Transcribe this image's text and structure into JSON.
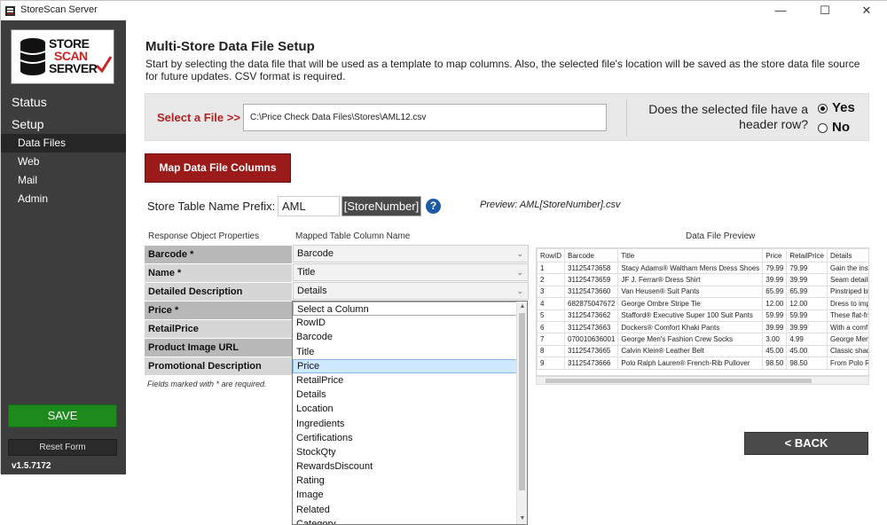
{
  "window": {
    "title": "StoreScan Server",
    "controls": {
      "minimize": "—",
      "maximize": "☐",
      "close": "✕"
    }
  },
  "logo": {
    "line1": "STORE",
    "line2": "SCAN",
    "line3": "SERVER"
  },
  "sidebar": {
    "main_items": [
      "Status",
      "Setup"
    ],
    "sub_items": [
      "Data Files",
      "Web",
      "Mail",
      "Admin"
    ],
    "active_sub": "Data Files",
    "save_label": "SAVE",
    "reset_label": "Reset Form",
    "version": "v1.5.7172"
  },
  "page": {
    "title": "Multi-Store Data File Setup",
    "description": "Start by selecting the data file that will be used as a template to map columns.  Also, the selected file's location will be saved as the store data file source for future updates.  CSV format is required."
  },
  "file_select": {
    "label": "Select a File >>",
    "value": "C:\\Price Check Data Files\\Stores\\AML12.csv",
    "header_question": "Does the selected file have a header row?",
    "options": [
      {
        "label": "Yes",
        "selected": true
      },
      {
        "label": "No",
        "selected": false
      }
    ]
  },
  "map_button_label": "Map Data File Columns",
  "prefix": {
    "label": "Store Table Name Prefix:",
    "value": "AML",
    "suffix": "[StoreNumber]",
    "help_icon": "?",
    "preview": "Preview: AML[StoreNumber].csv"
  },
  "mapping": {
    "col_properties": "Response Object Properties",
    "col_mapped": "Mapped Table Column Name",
    "rows": [
      {
        "property": "Barcode *",
        "mapped": "Barcode"
      },
      {
        "property": "Name *",
        "mapped": "Title"
      },
      {
        "property": "Detailed Description",
        "mapped": "Details"
      },
      {
        "property": "Price *",
        "mapped": "Select a Column"
      },
      {
        "property": "RetailPrice",
        "mapped": ""
      },
      {
        "property": "Product Image URL",
        "mapped": ""
      },
      {
        "property": "Promotional Description",
        "mapped": ""
      }
    ],
    "required_note": "Fields marked with * are required."
  },
  "dropdown": {
    "selected": "Price",
    "options": [
      "Select a Column",
      "RowID",
      "Barcode",
      "Title",
      "Price",
      "RetailPrice",
      "Details",
      "Location",
      "Ingredients",
      "Certifications",
      "StockQty",
      "RewardsDiscount",
      "Rating",
      "Image",
      "Related",
      "Category"
    ]
  },
  "preview_table": {
    "title": "Data File Preview",
    "headers": [
      "RowID",
      "Barcode",
      "Title",
      "Price",
      "RetailPrice",
      "Details"
    ],
    "rows": [
      [
        "1",
        "31125473658",
        "Stacy Adams® Waltham Mens Dress Shoes",
        "79.99",
        "79.99",
        "Gain the inst"
      ],
      [
        "2",
        "31125473659",
        "JF J. Ferrar® Dress Shirt",
        "39.99",
        "39.99",
        "Seam details"
      ],
      [
        "3",
        "31125473660",
        "Van Heusen® Suit Pants",
        "65.99",
        "65.99",
        "Pinstriped bl"
      ],
      [
        "4",
        "682875047672",
        "George Ombre Stripe Tie",
        "12.00",
        "12.00",
        "Dress to imp"
      ],
      [
        "5",
        "31125473662",
        "Stafford® Executive Super 100 Suit Pants",
        "59.99",
        "59.99",
        "These flat-fr"
      ],
      [
        "6",
        "31125473663",
        "Dockers® Comfort Khaki Pants",
        "39.99",
        "39.99",
        "With a comf"
      ],
      [
        "7",
        "070010636001",
        "George Men's Fashion Crew Socks",
        "3.00",
        "4.99",
        "George Men"
      ],
      [
        "8",
        "31125473665",
        "Calvin Klein® Leather Belt",
        "45.00",
        "45.00",
        "Classic shad"
      ],
      [
        "9",
        "31125473666",
        "Polo Ralph Lauren® French-Rib Pullover",
        "98.50",
        "98.50",
        "From Polo R"
      ]
    ]
  },
  "back_label": "< BACK"
}
